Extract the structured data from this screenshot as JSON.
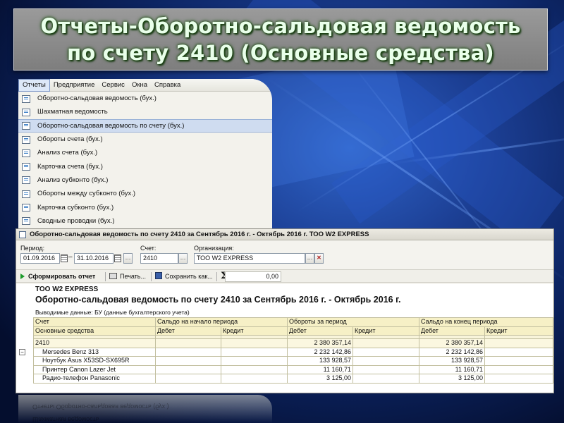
{
  "slide": {
    "title_line1": "Отчеты-Оборотно-сальдовая ведомость",
    "title_line2": "по счету 2410 (Основные средства)",
    "title_color": "#e9ffea",
    "accent_blue": "#2f64c9"
  },
  "menu": {
    "bar": [
      "Отчеты",
      "Предприятие",
      "Сервис",
      "Окна",
      "Справка"
    ],
    "items": [
      {
        "label": "Оборотно-сальдовая ведомость (бух.)",
        "icon": "report-icon"
      },
      {
        "label": "Шахматная ведомость",
        "icon": "grid-report-icon"
      },
      {
        "label": "Оборотно-сальдовая ведомость по счету (бух.)",
        "icon": "report-icon",
        "selected": true
      },
      {
        "label": "Обороты счета (бух.)",
        "icon": "report-icon"
      },
      {
        "label": "Анализ счета (бух.)",
        "icon": "analysis-icon"
      },
      {
        "label": "Карточка счета (бух.)",
        "icon": "card-icon"
      },
      {
        "label": "Анализ субконто (бух.)",
        "icon": "analysis-icon"
      },
      {
        "label": "Обороты между субконто (бух.)",
        "icon": "report-icon"
      },
      {
        "label": "Карточка субконто (бух.)",
        "icon": "card-icon"
      },
      {
        "label": "Сводные проводки (бух.)",
        "icon": "report-icon"
      }
    ]
  },
  "report": {
    "window_title": "Оборотно-сальдовая ведомость по счету 2410 за Сентябрь 2016 г. - Октябрь 2016 г. ТОО W2 EXPRESS",
    "period_label": "Период:",
    "period_from": "01.09.2016",
    "period_to": "31.10.2016",
    "account_label": "Счет:",
    "account_value": "2410",
    "org_label": "Организация:",
    "org_value": "ТОО W2 EXPRESS",
    "run_button": "Сформировать отчет",
    "print_button": "Печать...",
    "save_button": "Сохранить как...",
    "sum_value": "0,00",
    "org_header": "ТОО W2 EXPRESS",
    "report_title": "Оборотно-сальдовая ведомость по счету 2410 за Сентябрь 2016 г. - Октябрь 2016 г.",
    "output_data": "Выводимые данные:  БУ (данные бухгалтерского учета)",
    "columns": {
      "account": "Счет",
      "account_sub": "Основные средства",
      "opening": "Сальдо на начало периода",
      "turnover": "Обороты за период",
      "closing": "Сальдо на конец периода",
      "debit": "Дебет",
      "credit": "Кредит"
    },
    "rows": [
      {
        "name": "2410",
        "turn_debit": "2 380 357,14",
        "close_debit": "2 380 357,14",
        "group": true
      },
      {
        "name": "Mersedes Benz 313",
        "turn_debit": "2 232 142,86",
        "close_debit": "2 232 142,86"
      },
      {
        "name": "Ноутбук Asus X53SD-SX695R",
        "turn_debit": "133 928,57",
        "close_debit": "133 928,57"
      },
      {
        "name": "Принтер Canon Lazer Jet",
        "turn_debit": "11 160,71",
        "close_debit": "11 160,71"
      },
      {
        "name": "Радио-телефон Panasonic",
        "turn_debit": "3 125,00",
        "close_debit": "3 125,00"
      }
    ]
  },
  "reflection": {
    "line1": "Отчеты Оборотно-сальдовая ведомость (бух.)",
    "line2": "Шахматная ведомость"
  }
}
